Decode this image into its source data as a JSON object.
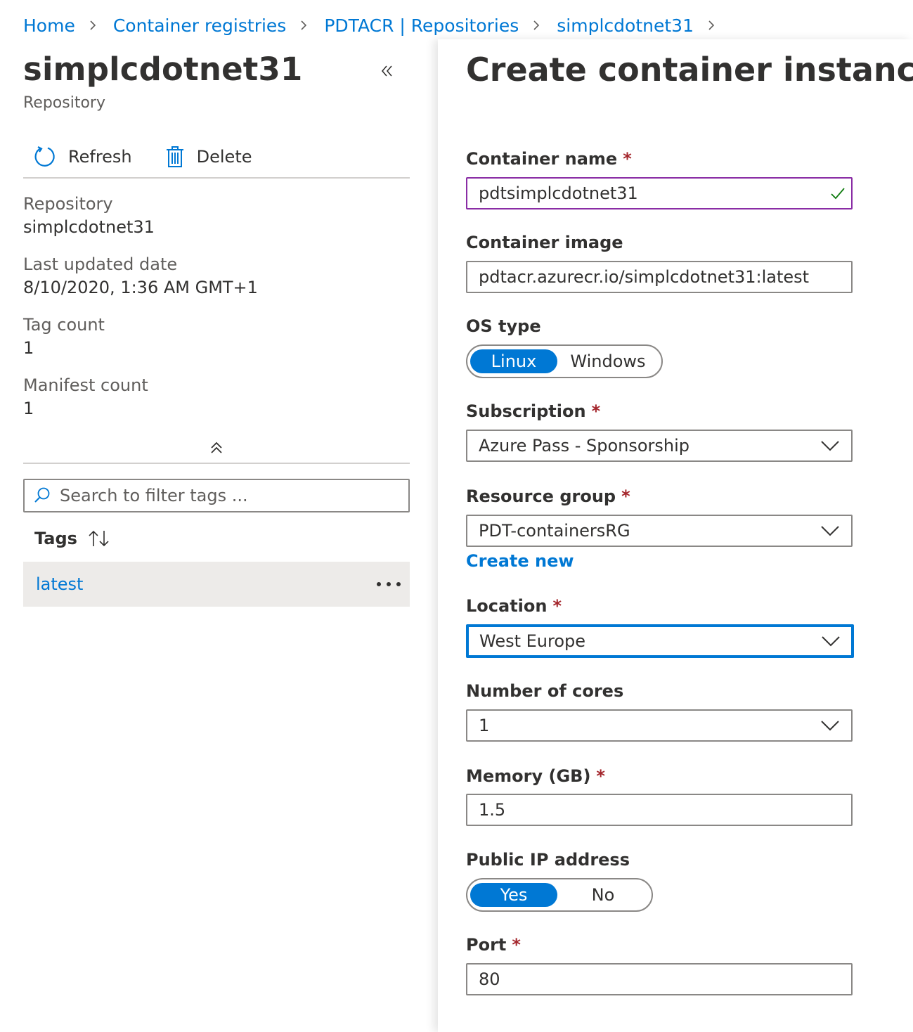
{
  "breadcrumb": {
    "items": [
      "Home",
      "Container registries",
      "PDTACR | Repositories",
      "simplcdotnet31"
    ]
  },
  "left": {
    "title": "simplcdotnet31",
    "subtitle": "Repository",
    "toolbar": {
      "refresh_label": "Refresh",
      "delete_label": "Delete"
    },
    "essentials": [
      {
        "label": "Repository",
        "value": "simplcdotnet31"
      },
      {
        "label": "Last updated date",
        "value": "8/10/2020, 1:36 AM GMT+1"
      },
      {
        "label": "Tag count",
        "value": "1"
      },
      {
        "label": "Manifest count",
        "value": "1"
      }
    ],
    "search": {
      "placeholder": "Search to filter tags ..."
    },
    "tags_header": "Tags",
    "tags": [
      "latest"
    ]
  },
  "form": {
    "title": "Create container instance",
    "container_name": {
      "label": "Container name",
      "required": "*",
      "value": "pdtsimplcdotnet31"
    },
    "container_image": {
      "label": "Container image",
      "value": "pdtacr.azurecr.io/simplcdotnet31:latest"
    },
    "os_type": {
      "label": "OS type",
      "options": [
        "Linux",
        "Windows"
      ],
      "selected": "Linux"
    },
    "subscription": {
      "label": "Subscription",
      "required": "*",
      "value": "Azure Pass - Sponsorship"
    },
    "resource_group": {
      "label": "Resource group",
      "required": "*",
      "value": "PDT-containersRG",
      "create_new": "Create new"
    },
    "location": {
      "label": "Location",
      "required": "*",
      "value": "West Europe"
    },
    "cores": {
      "label": "Number of cores",
      "value": "1"
    },
    "memory": {
      "label": "Memory (GB)",
      "required": "*",
      "value": "1.5"
    },
    "public_ip": {
      "label": "Public IP address",
      "options": [
        "Yes",
        "No"
      ],
      "selected": "Yes"
    },
    "port": {
      "label": "Port",
      "required": "*",
      "value": "80"
    }
  },
  "colors": {
    "accent": "#0078d4",
    "required": "#a4262c",
    "valid_check": "#107c10",
    "name_field_border": "#8a2da5"
  }
}
